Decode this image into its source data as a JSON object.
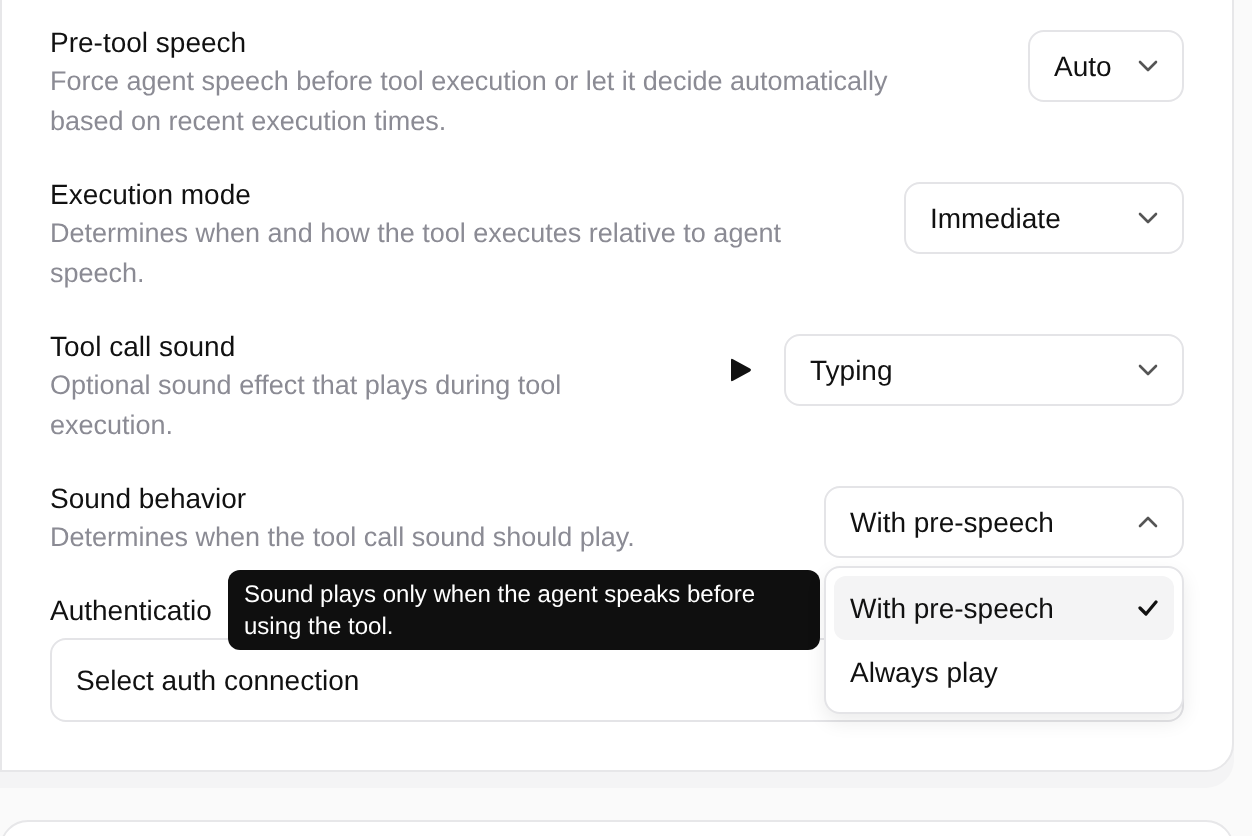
{
  "settings": [
    {
      "kind": "select",
      "label": "Pre-tool speech",
      "description": "Force agent speech before tool execution or let it decide automatically based on recent execution times.",
      "value": "Auto",
      "expanded": false
    },
    {
      "kind": "select",
      "label": "Execution mode",
      "description": "Determines when and how the tool executes relative to agent speech.",
      "value": "Immediate",
      "expanded": false
    },
    {
      "kind": "sound",
      "label": "Tool call sound",
      "description": "Optional sound effect that plays during tool execution.",
      "value": "Typing",
      "expanded": false
    },
    {
      "kind": "select",
      "label": "Sound behavior",
      "description": "Determines when the tool call sound should play.",
      "value": "With pre-speech",
      "expanded": true,
      "options": [
        {
          "label": "With pre-speech",
          "selected": true
        },
        {
          "label": "Always play",
          "selected": false
        }
      ]
    }
  ],
  "authentication": {
    "label": "Authenticatio",
    "placeholder": "Select auth connection"
  },
  "tooltip": "Sound plays only when the agent speaks before using the tool."
}
